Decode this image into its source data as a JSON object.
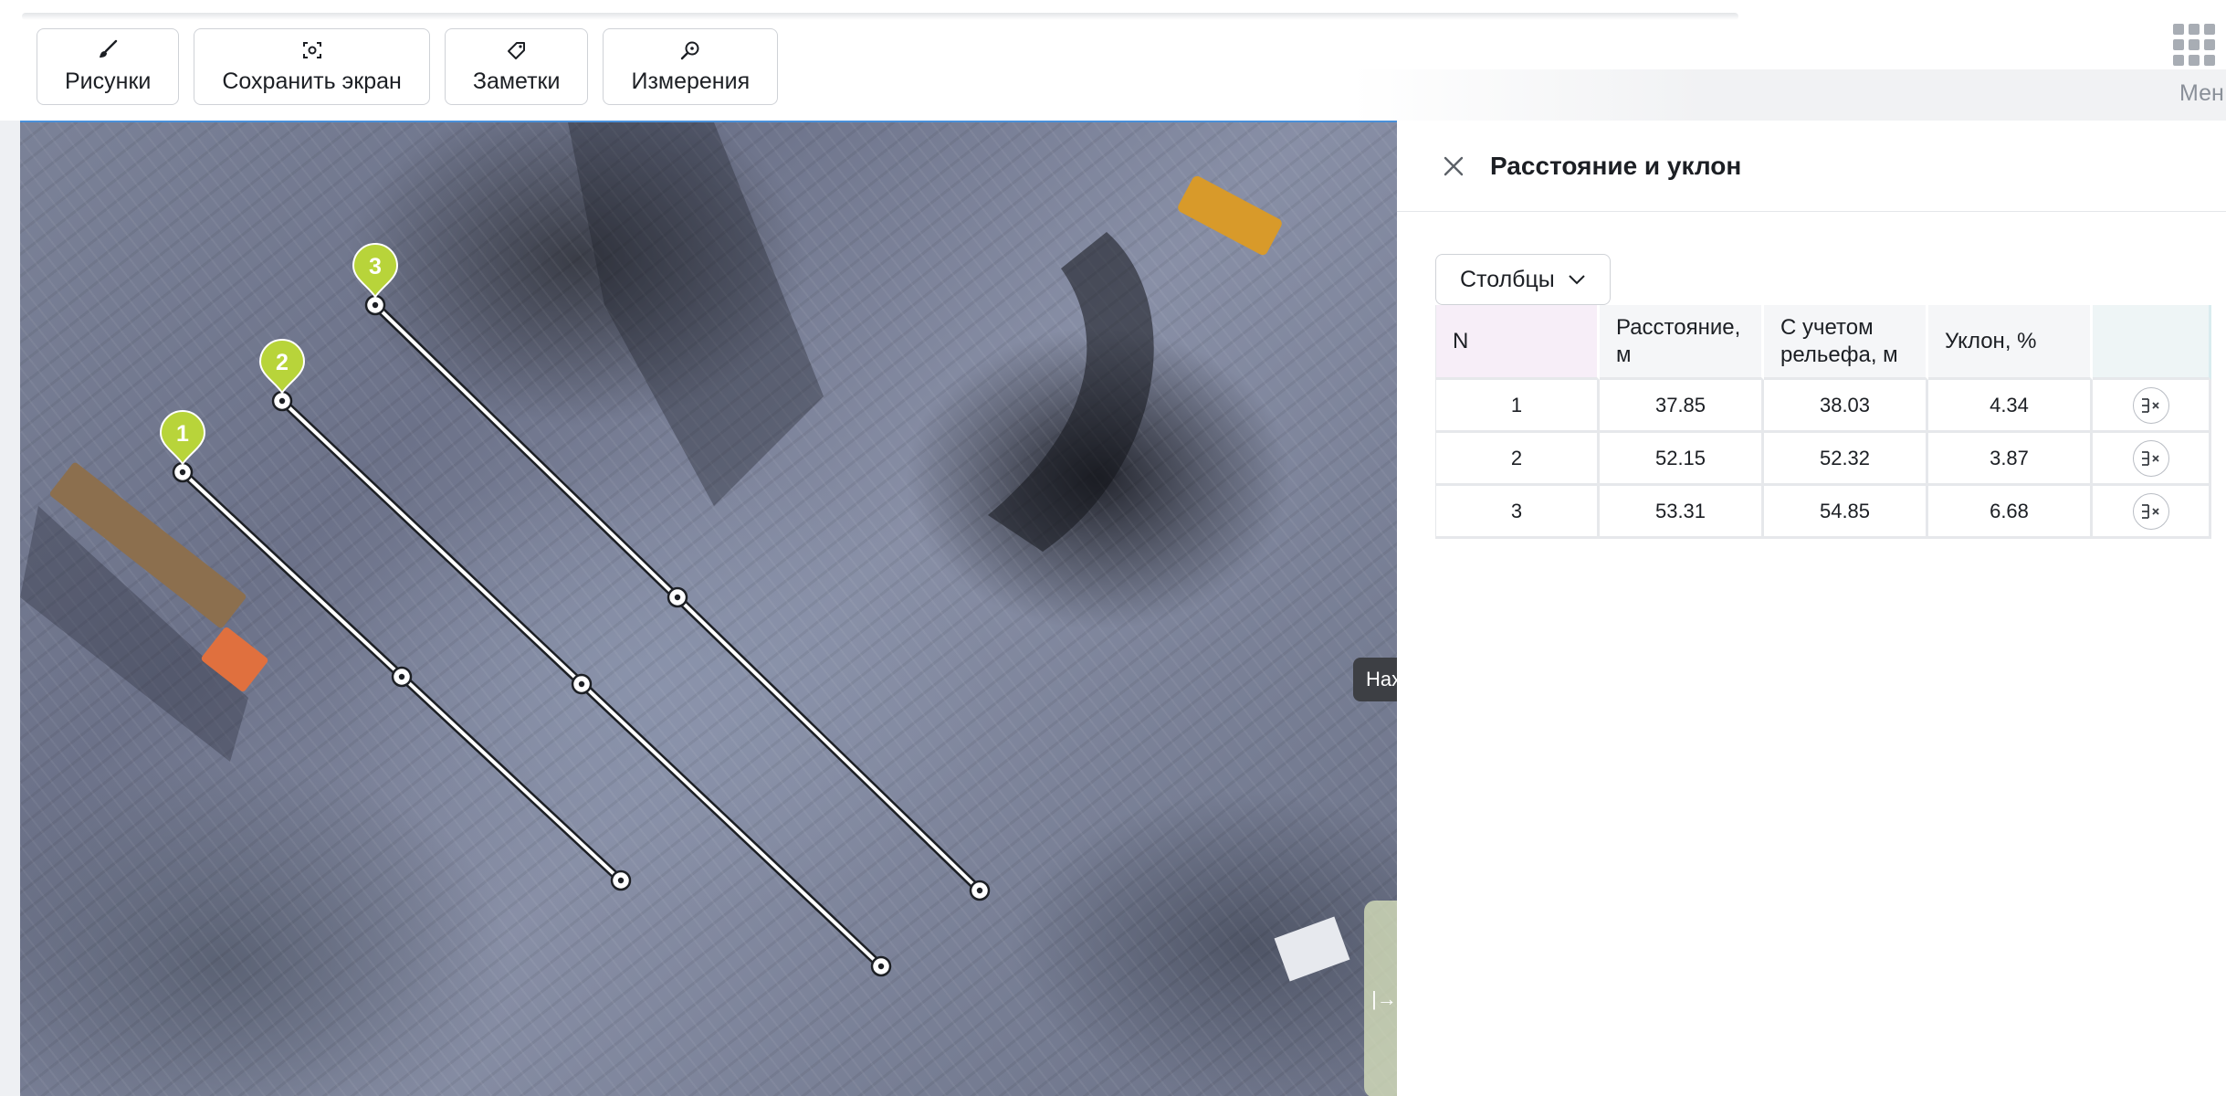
{
  "toolbar": {
    "buttons": [
      {
        "label": "Рисунки",
        "icon": "brush-icon"
      },
      {
        "label": "Сохранить экран",
        "icon": "screenshot-icon"
      },
      {
        "label": "Заметки",
        "icon": "tag-icon"
      },
      {
        "label": "Измерения",
        "icon": "measure-search-icon"
      }
    ],
    "menu_label": "Мен",
    "menu_icon": "grid-icon"
  },
  "map": {
    "hint_text": "Нах",
    "side_tab_glyph": "|→",
    "accent_color": "#4a90d9",
    "marker_color": "#b8d43a",
    "lines": [
      {
        "label": "1"
      },
      {
        "label": "2"
      },
      {
        "label": "3"
      }
    ]
  },
  "panel": {
    "title": "Расстояние и уклон",
    "close_icon": "close-icon",
    "columns_button": "Столбцы",
    "headers": {
      "n": "N",
      "distance": "Расстояние, м",
      "relief": "С учетом рельефа, м",
      "slope": "Уклон, %"
    },
    "rows": [
      {
        "n": "1",
        "distance": "37.85",
        "relief": "38.03",
        "slope": "4.34"
      },
      {
        "n": "2",
        "distance": "52.15",
        "relief": "52.32",
        "slope": "3.87"
      },
      {
        "n": "3",
        "distance": "53.31",
        "relief": "54.85",
        "slope": "6.68"
      }
    ]
  }
}
